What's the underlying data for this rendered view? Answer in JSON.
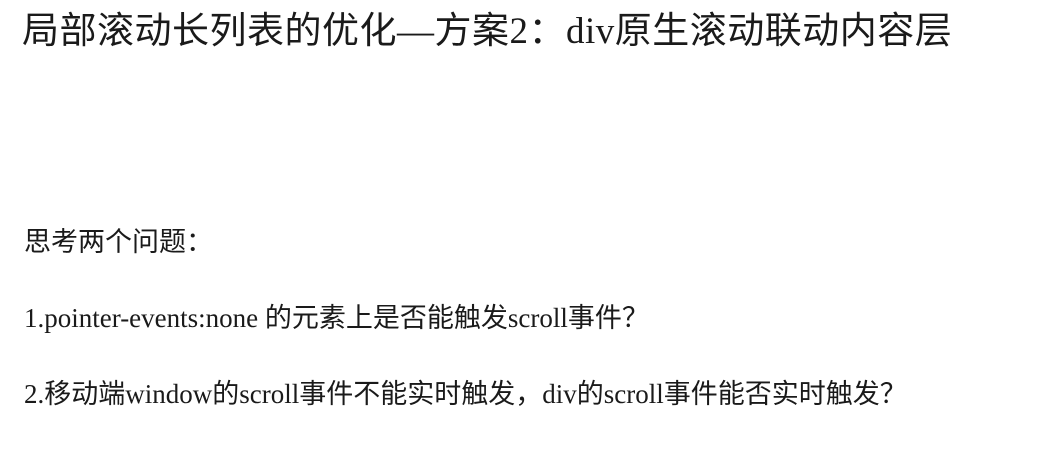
{
  "slide": {
    "title": "局部滚动长列表的优化—方案2：div原生滚动联动内容层",
    "paragraphs": [
      "思考两个问题：",
      "1.pointer-events:none 的元素上是否能触发scroll事件？",
      "2.移动端window的scroll事件不能实时触发，div的scroll事件能否实时触发？"
    ]
  },
  "colors": {
    "background": "#ffffff",
    "text": "#1a1a1a"
  }
}
